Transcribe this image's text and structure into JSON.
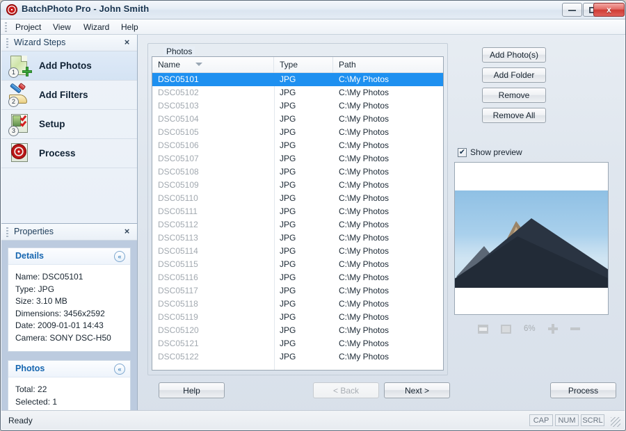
{
  "window": {
    "title": "BatchPhoto Pro - John Smith",
    "app_icon": "spiral-logo-icon",
    "minimize_label": "Minimize",
    "maximize_label": "Restore",
    "close_label": "Close",
    "close_glyph": "x"
  },
  "menubar": {
    "items": [
      {
        "label": "Project",
        "accel": "P"
      },
      {
        "label": "View",
        "accel": "V"
      },
      {
        "label": "Wizard",
        "accel": "z"
      },
      {
        "label": "Help",
        "accel": "H"
      }
    ]
  },
  "wizard_pane": {
    "title": "Wizard Steps",
    "close_glyph": "×",
    "steps": [
      {
        "number": "1",
        "label": "Add Photos",
        "icon": "add-photos-icon",
        "active": true
      },
      {
        "number": "2",
        "label": "Add Filters",
        "icon": "add-filters-icon",
        "active": false
      },
      {
        "number": "3",
        "label": "Setup",
        "icon": "setup-icon",
        "active": false
      },
      {
        "number": "",
        "label": "Process",
        "icon": "process-icon",
        "active": false
      }
    ]
  },
  "properties_pane": {
    "title": "Properties",
    "close_glyph": "×",
    "cards": [
      {
        "title": "Details",
        "chevron": "«",
        "lines": [
          "Name: DSC05101",
          "Type: JPG",
          "Size: 3.10 MB",
          "Dimensions: 3456x2592",
          "Date: 2009-01-01 14:43",
          "Camera: SONY DSC-H50"
        ]
      },
      {
        "title": "Photos",
        "chevron": "«",
        "lines": [
          "Total: 22",
          "Selected: 1"
        ]
      }
    ]
  },
  "photos_group": {
    "legend": "Photos",
    "columns": [
      "Name",
      "Type",
      "Path"
    ],
    "sort_column": "Name",
    "sort_indicator": "descending-triangle-icon",
    "rows": [
      {
        "name": "DSC05101",
        "type": "JPG",
        "path": "C:\\My Photos",
        "selected": true
      },
      {
        "name": "DSC05102",
        "type": "JPG",
        "path": "C:\\My Photos",
        "selected": false
      },
      {
        "name": "DSC05103",
        "type": "JPG",
        "path": "C:\\My Photos",
        "selected": false
      },
      {
        "name": "DSC05104",
        "type": "JPG",
        "path": "C:\\My Photos",
        "selected": false
      },
      {
        "name": "DSC05105",
        "type": "JPG",
        "path": "C:\\My Photos",
        "selected": false
      },
      {
        "name": "DSC05106",
        "type": "JPG",
        "path": "C:\\My Photos",
        "selected": false
      },
      {
        "name": "DSC05107",
        "type": "JPG",
        "path": "C:\\My Photos",
        "selected": false
      },
      {
        "name": "DSC05108",
        "type": "JPG",
        "path": "C:\\My Photos",
        "selected": false
      },
      {
        "name": "DSC05109",
        "type": "JPG",
        "path": "C:\\My Photos",
        "selected": false
      },
      {
        "name": "DSC05110",
        "type": "JPG",
        "path": "C:\\My Photos",
        "selected": false
      },
      {
        "name": "DSC05111",
        "type": "JPG",
        "path": "C:\\My Photos",
        "selected": false
      },
      {
        "name": "DSC05112",
        "type": "JPG",
        "path": "C:\\My Photos",
        "selected": false
      },
      {
        "name": "DSC05113",
        "type": "JPG",
        "path": "C:\\My Photos",
        "selected": false
      },
      {
        "name": "DSC05114",
        "type": "JPG",
        "path": "C:\\My Photos",
        "selected": false
      },
      {
        "name": "DSC05115",
        "type": "JPG",
        "path": "C:\\My Photos",
        "selected": false
      },
      {
        "name": "DSC05116",
        "type": "JPG",
        "path": "C:\\My Photos",
        "selected": false
      },
      {
        "name": "DSC05117",
        "type": "JPG",
        "path": "C:\\My Photos",
        "selected": false
      },
      {
        "name": "DSC05118",
        "type": "JPG",
        "path": "C:\\My Photos",
        "selected": false
      },
      {
        "name": "DSC05119",
        "type": "JPG",
        "path": "C:\\My Photos",
        "selected": false
      },
      {
        "name": "DSC05120",
        "type": "JPG",
        "path": "C:\\My Photos",
        "selected": false
      },
      {
        "name": "DSC05121",
        "type": "JPG",
        "path": "C:\\My Photos",
        "selected": false
      },
      {
        "name": "DSC05122",
        "type": "JPG",
        "path": "C:\\My Photos",
        "selected": false
      }
    ]
  },
  "side_buttons": [
    {
      "label": "Add Photo(s)"
    },
    {
      "label": "Add Folder"
    },
    {
      "label": "Remove"
    },
    {
      "label": "Remove All"
    }
  ],
  "preview": {
    "checkbox_label": "Show preview",
    "checkbox_checked": true,
    "check_glyph": "✔",
    "image_subject": "mountain-peak-photo",
    "zoom_level": "6%",
    "toolbar_icons": [
      "fit-width-icon",
      "fit-page-icon",
      "zoom-in-icon",
      "zoom-out-icon"
    ]
  },
  "bottom_buttons": {
    "help": "Help",
    "back": "< Back",
    "back_disabled": true,
    "next": "Next >",
    "process": "Process"
  },
  "statusbar": {
    "text": "Ready",
    "indicators": [
      "CAP",
      "NUM",
      "SCRL"
    ],
    "resize_grip": "resize-grip-icon"
  },
  "colors": {
    "selection_blue": "#1e90f0",
    "card_title_blue": "#1666b0",
    "accent_red": "#c01818"
  }
}
